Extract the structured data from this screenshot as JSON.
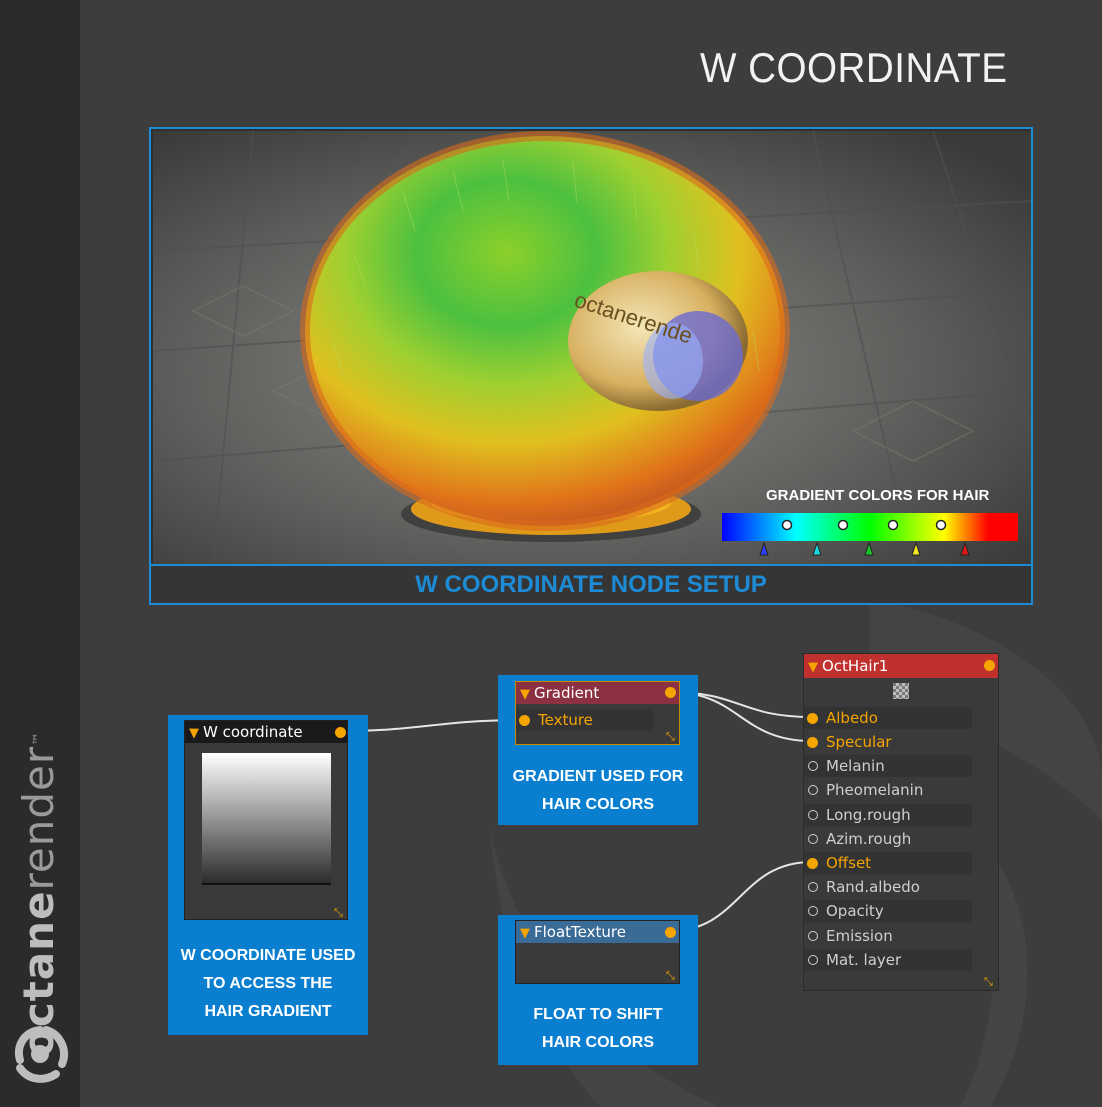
{
  "page": {
    "title": "W COORDINATE"
  },
  "brand": {
    "name_bold": "octane",
    "name_light": "render",
    "tm": "™"
  },
  "render": {
    "caption": "W COORDINATE NODE SETUP",
    "gradient_label": "GRADIENT COLORS FOR HAIR",
    "gradient_stops": [
      "#0000ff",
      "#00ffff",
      "#00ff00",
      "#ffff00",
      "#ff0000"
    ],
    "pedestal_text": "octanerende"
  },
  "nodes": {
    "w_coordinate": {
      "title": "W coordinate",
      "caption_lines": [
        "W COORDINATE USED",
        "TO ACCESS THE",
        "HAIR GRADIENT"
      ]
    },
    "gradient": {
      "title": "Gradient",
      "input": "Texture",
      "caption_lines": [
        "GRADIENT USED FOR",
        "HAIR COLORS"
      ]
    },
    "float_texture": {
      "title": "FloatTexture",
      "caption_lines": [
        "FLOAT TO SHIFT",
        "HAIR COLORS"
      ]
    },
    "oct_hair": {
      "title": "OctHair1",
      "pins": [
        {
          "label": "Albedo",
          "connected": true
        },
        {
          "label": "Specular",
          "connected": true
        },
        {
          "label": "Melanin",
          "connected": false
        },
        {
          "label": "Pheomelanin",
          "connected": false
        },
        {
          "label": "Long.rough",
          "connected": false
        },
        {
          "label": "Azim.rough",
          "connected": false
        },
        {
          "label": "Offset",
          "connected": true
        },
        {
          "label": "Rand.albedo",
          "connected": false
        },
        {
          "label": "Opacity",
          "connected": false
        },
        {
          "label": "Emission",
          "connected": false
        },
        {
          "label": "Mat. layer",
          "connected": false
        }
      ]
    }
  },
  "colors": {
    "accent_blue": "#0a7fcf",
    "port_orange": "#f5a400",
    "hair_header": "#c0302e",
    "gradient_header": "#8c3141",
    "float_header": "#3a6a96"
  }
}
